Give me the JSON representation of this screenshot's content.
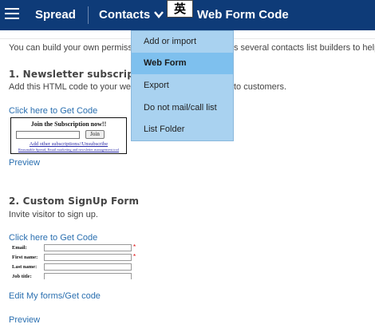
{
  "topbar": {
    "brand": "Spread",
    "nav_contacts": "Contacts",
    "ime_indicator": "英",
    "page_title": "Web Form Code"
  },
  "content": {
    "intro_left": "You can build your own permissi",
    "intro_right": "s several contacts list builders to help",
    "section1": {
      "title": "1. Newsletter subscripti",
      "desc_left": "Add this HTML code to your web",
      "desc_right": "to customers.",
      "get_code_link": "Click here to Get Code",
      "preview_link": "Preview",
      "widget": {
        "title": "Join the Subscription now!!",
        "button": "Join",
        "link1": "Add other subscriptions//Unsubscribe",
        "link2": "Reasonable Spread, Email marketing and newsletter management tool"
      }
    },
    "section2": {
      "title": "2. Custom SignUp Form",
      "desc": "Invite visitor to sign up.",
      "get_code_link": "Click here to Get Code",
      "edit_link": "Edit My forms/Get code",
      "preview_link": "Preview",
      "form_fields": [
        {
          "label": "Email:",
          "required": "*"
        },
        {
          "label": "First name:",
          "required": "*"
        },
        {
          "label": "Last name:",
          "required": ""
        },
        {
          "label": "Job title:",
          "required": ""
        }
      ]
    }
  },
  "dropdown": {
    "items": [
      {
        "label": "Add or import"
      },
      {
        "label": "Web Form"
      },
      {
        "label": "Export"
      },
      {
        "label": "Do not mail/call list"
      },
      {
        "label": "List Folder"
      }
    ],
    "active_index": 1
  },
  "colors": {
    "header_bg": "#0e3b78",
    "dropdown_bg": "#a9d2f0",
    "dropdown_active": "#7ec0ee",
    "link": "#2a6fb0"
  }
}
